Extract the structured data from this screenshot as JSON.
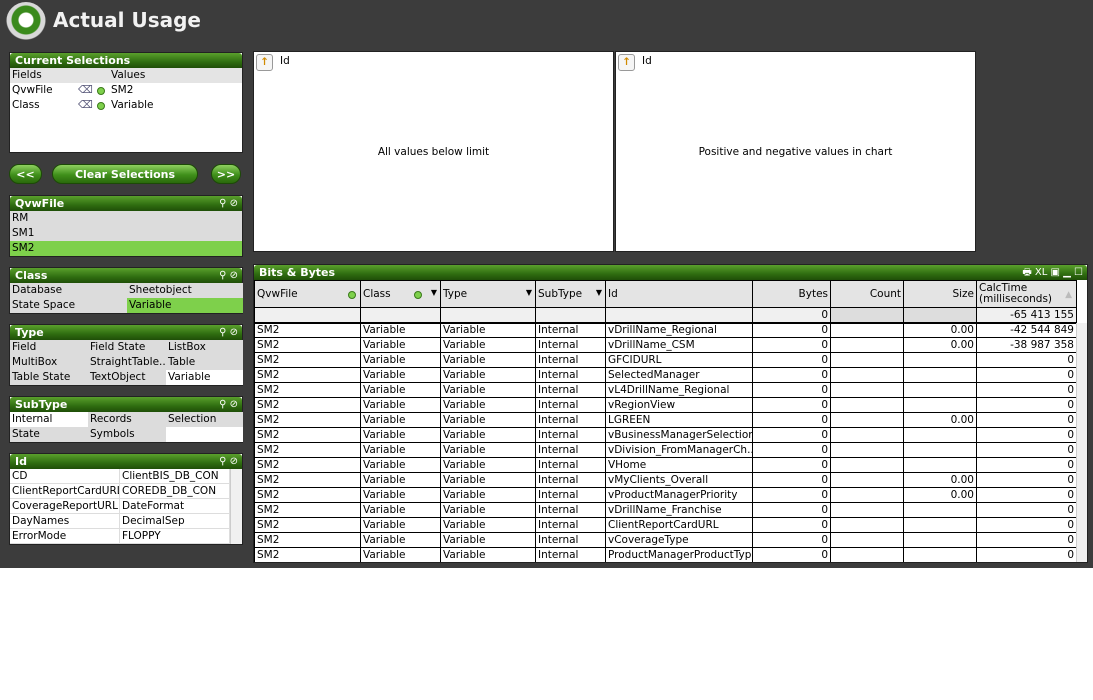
{
  "app": {
    "title": "Actual Usage"
  },
  "current_selections": {
    "title": "Current Selections",
    "col_fields": "Fields",
    "col_values": "Values",
    "items": [
      {
        "field": "QvwFile",
        "value": "SM2"
      },
      {
        "field": "Class",
        "value": "Variable"
      }
    ]
  },
  "nav": {
    "back": "<<",
    "clear": "Clear Selections",
    "forward": ">>"
  },
  "listboxes": {
    "qvwfile": {
      "title": "QvwFile",
      "items": [
        "RM",
        "SM1",
        "SM2"
      ],
      "selected": "SM2"
    },
    "class": {
      "title": "Class",
      "items": [
        "Database",
        "Sheetobject",
        "State Space",
        "Variable"
      ],
      "selected": "Variable"
    },
    "type": {
      "title": "Type",
      "items": [
        "Field",
        "Field State",
        "ListBox",
        "MultiBox",
        "StraightTable...",
        "Table",
        "Table State",
        "TextObject",
        "Variable"
      ]
    },
    "subtype": {
      "title": "SubType",
      "items": [
        "Internal",
        "Records",
        "Selection",
        "State",
        "Symbols",
        ""
      ]
    },
    "id": {
      "title": "Id",
      "items": [
        "CD",
        "ClientBIS_DB_CON",
        "ClientReportCardURL",
        "COREDB_DB_CON",
        "CoverageReportURL",
        "DateFormat",
        "DayNames",
        "DecimalSep",
        "ErrorMode",
        "FLOPPY"
      ]
    }
  },
  "charts": [
    {
      "dim": "Id",
      "message": "All values below limit"
    },
    {
      "dim": "Id",
      "message": "Positive and negative values in chart"
    }
  ],
  "table": {
    "title": "Bits & Bytes",
    "toolbar": [
      "print-icon",
      "XL",
      "restore-icon",
      "minimize-icon",
      "maximize-icon"
    ],
    "columns": [
      "QvwFile",
      "Class",
      "Type",
      "SubType",
      "Id",
      "Bytes",
      "Count",
      "Size",
      "CalcTime (milliseconds)"
    ],
    "totals": [
      "",
      "",
      "",
      "",
      "",
      "0",
      "",
      "",
      "-65 413 155"
    ],
    "rows": [
      [
        "SM2",
        "Variable",
        "Variable",
        "Internal",
        "vDrillName_Regional",
        "0",
        "",
        "0.00",
        "-42 544 849"
      ],
      [
        "SM2",
        "Variable",
        "Variable",
        "Internal",
        "vDrillName_CSM",
        "0",
        "",
        "0.00",
        "-38 987 358"
      ],
      [
        "SM2",
        "Variable",
        "Variable",
        "Internal",
        "GFCIDURL",
        "0",
        "",
        "",
        "0"
      ],
      [
        "SM2",
        "Variable",
        "Variable",
        "Internal",
        "SelectedManager",
        "0",
        "",
        "",
        "0"
      ],
      [
        "SM2",
        "Variable",
        "Variable",
        "Internal",
        "vL4DrillName_Regional",
        "0",
        "",
        "",
        "0"
      ],
      [
        "SM2",
        "Variable",
        "Variable",
        "Internal",
        "vRegionView",
        "0",
        "",
        "",
        "0"
      ],
      [
        "SM2",
        "Variable",
        "Variable",
        "Internal",
        "LGREEN",
        "0",
        "",
        "0.00",
        "0"
      ],
      [
        "SM2",
        "Variable",
        "Variable",
        "Internal",
        "vBusinessManagerSelection",
        "0",
        "",
        "",
        "0"
      ],
      [
        "SM2",
        "Variable",
        "Variable",
        "Internal",
        "vDivision_FromManagerCh...",
        "0",
        "",
        "",
        "0"
      ],
      [
        "SM2",
        "Variable",
        "Variable",
        "Internal",
        "VHome",
        "0",
        "",
        "",
        "0"
      ],
      [
        "SM2",
        "Variable",
        "Variable",
        "Internal",
        "vMyClients_Overall",
        "0",
        "",
        "0.00",
        "0"
      ],
      [
        "SM2",
        "Variable",
        "Variable",
        "Internal",
        "vProductManagerPriority",
        "0",
        "",
        "0.00",
        "0"
      ],
      [
        "SM2",
        "Variable",
        "Variable",
        "Internal",
        "vDrillName_Franchise",
        "0",
        "",
        "",
        "0"
      ],
      [
        "SM2",
        "Variable",
        "Variable",
        "Internal",
        "ClientReportCardURL",
        "0",
        "",
        "",
        "0"
      ],
      [
        "SM2",
        "Variable",
        "Variable",
        "Internal",
        "vCoverageType",
        "0",
        "",
        "",
        "0"
      ],
      [
        "SM2",
        "Variable",
        "Variable",
        "Internal",
        "ProductManagerProductType",
        "0",
        "",
        "",
        "0"
      ]
    ]
  },
  "colors": {
    "selected": "#7ed04b",
    "caption": "#2f6d10",
    "background": "#3c3c3c"
  }
}
